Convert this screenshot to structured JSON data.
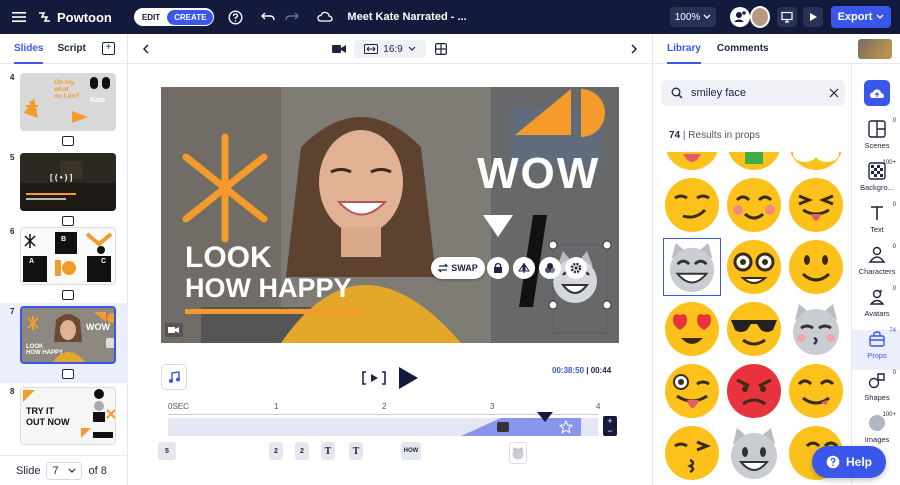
{
  "app": {
    "name": "Powtoon",
    "project_title": "Meet Kate Narrated - ...",
    "edit_label": "EDIT",
    "create_label": "CREATE",
    "zoom": "100%",
    "export_label": "Export"
  },
  "left": {
    "tabs": [
      "Slides",
      "Script"
    ],
    "slides": [
      {
        "num": "4"
      },
      {
        "num": "5"
      },
      {
        "num": "6"
      },
      {
        "num": "7"
      },
      {
        "num": "8"
      }
    ],
    "thumb4": {
      "line1": "Oh my,",
      "line2": "what",
      "line3": "do I do?",
      "name": "Kate"
    },
    "thumb5": {
      "text": "[ ( • ) ]"
    },
    "thumb7": {
      "wow": "WOW",
      "look": "LOOK",
      "happy": "HOW HAPPY"
    },
    "thumb8": {
      "l1": "TRY IT",
      "l2": "OUT NOW"
    },
    "footer": {
      "label": "Slide",
      "current": "7",
      "of": "of 8"
    }
  },
  "center": {
    "ratio": "16:9",
    "canvas": {
      "wow": "WOW",
      "look": "LOOK",
      "happy": "HOW HAPPY",
      "swap": "SWAP"
    },
    "time_current": "00:38:50",
    "time_total": "00:44",
    "ruler": [
      "0SEC",
      "1",
      "2",
      "3",
      "4"
    ],
    "chips": [
      "5",
      "2",
      "2",
      "T",
      "T",
      "HOW"
    ]
  },
  "right": {
    "tabs": [
      "Library",
      "Comments"
    ],
    "search_value": "smiley face",
    "results_count": "74",
    "results_label": "| Results in props",
    "nav": [
      {
        "label": "Scenes",
        "count": "0"
      },
      {
        "label": "Backgro...",
        "count": "100+"
      },
      {
        "label": "Text",
        "count": "0"
      },
      {
        "label": "Characters",
        "count": "0"
      },
      {
        "label": "Avatars",
        "count": "0"
      },
      {
        "label": "Props",
        "count": "74"
      },
      {
        "label": "Shapes",
        "count": "0"
      },
      {
        "label": "Images",
        "count": "100+"
      }
    ]
  },
  "help": {
    "label": "Help"
  },
  "colors": {
    "navy": "#131a3c",
    "accent": "#3a57ea",
    "orange": "#f59b2b",
    "emoji_yellow": "#fcc21b"
  }
}
